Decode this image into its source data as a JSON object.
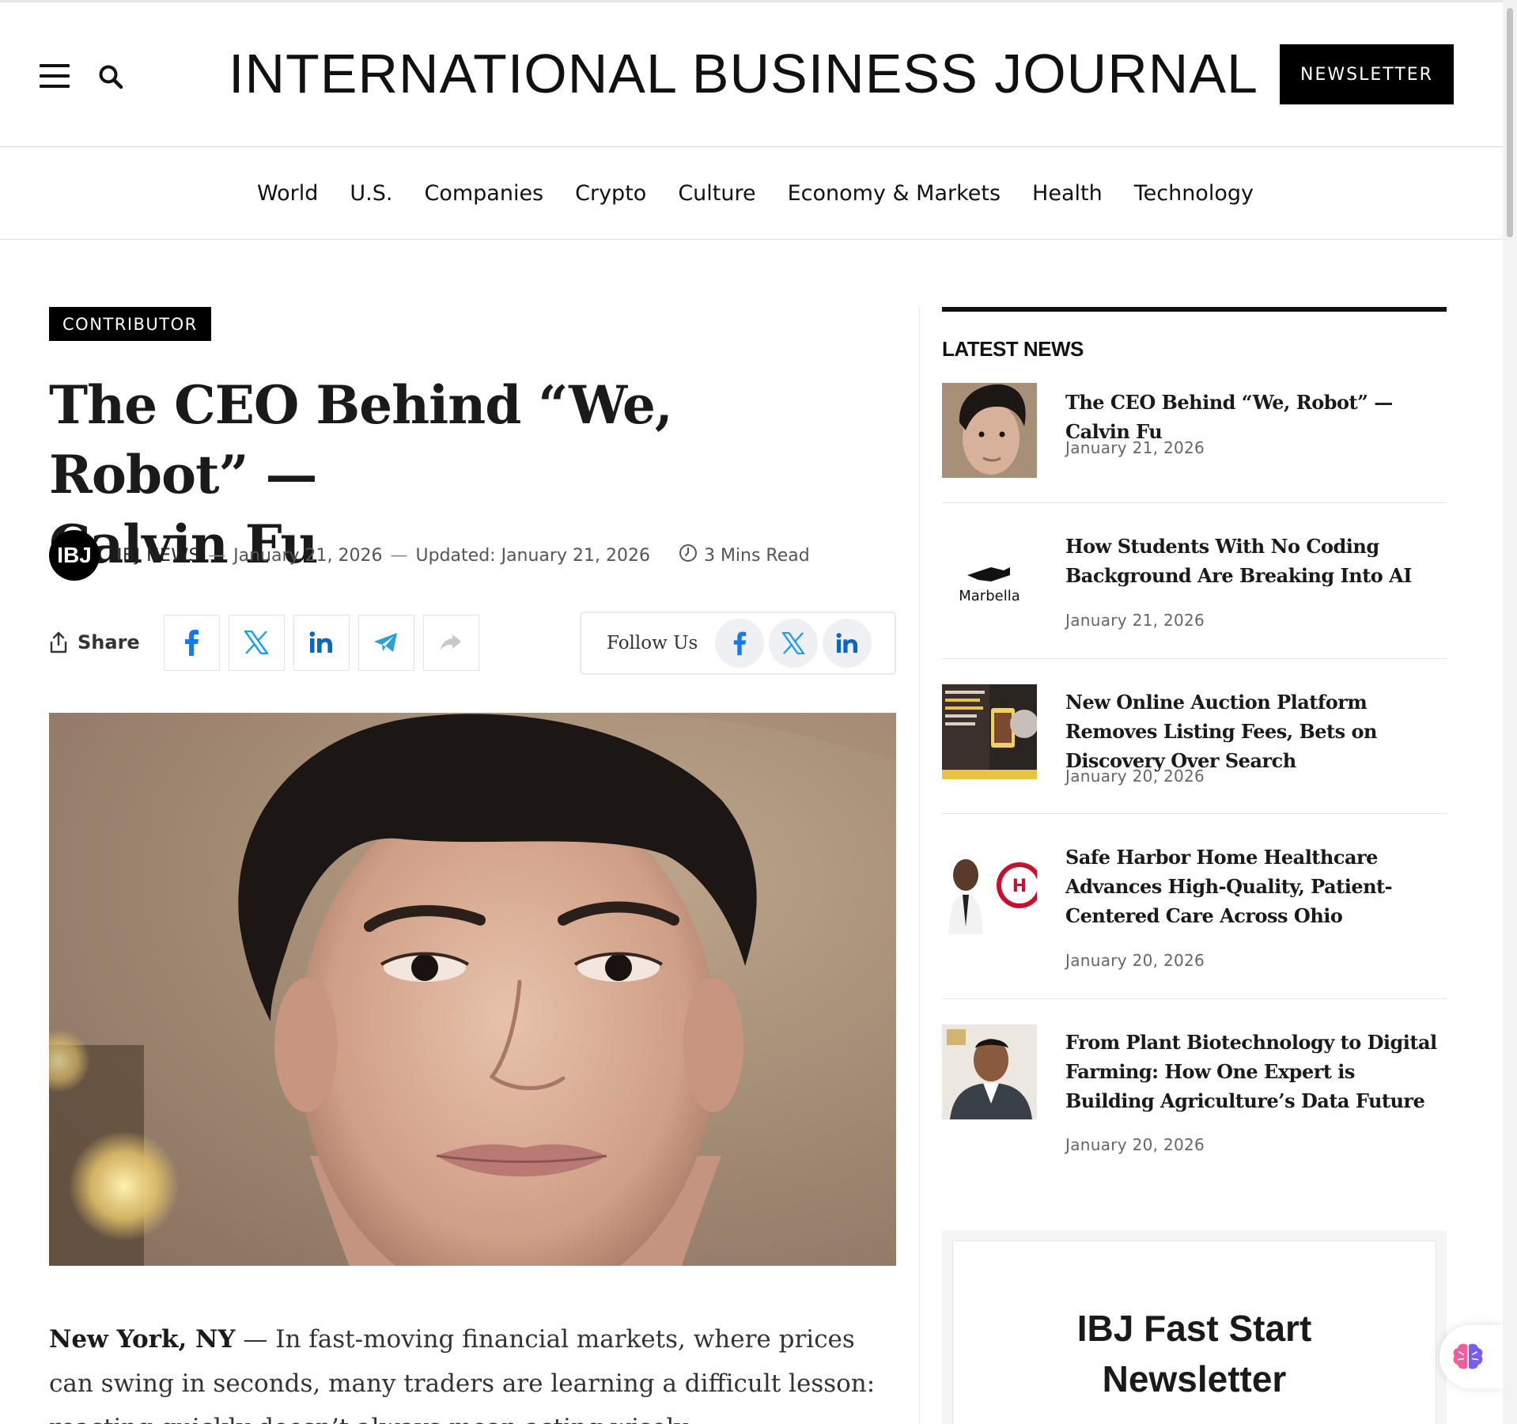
{
  "header": {
    "site_title": "INTERNATIONAL BUSINESS JOURNAL",
    "newsletter_label": "NEWSLETTER"
  },
  "nav": [
    "World",
    "U.S.",
    "Companies",
    "Crypto",
    "Culture",
    "Economy & Markets",
    "Health",
    "Technology"
  ],
  "article": {
    "category": "CONTRIBUTOR",
    "title_line1": "The CEO Behind “We, Robot” —",
    "title_line2": "Calvin Fu",
    "avatar_text": "IBJ",
    "author": "IBJ NEWS",
    "date_sep": "—",
    "published": "January 21, 2026",
    "updated_label": "Updated:",
    "updated": "January 21, 2026",
    "read_time": "3 Mins Read",
    "share_label": "Share",
    "follow_label": "Follow Us",
    "lead_location": "New York, NY",
    "lead_text": " — In fast-moving financial markets, where prices can swing in seconds, many traders are learning a difficult lesson: reacting quickly doesn’t always mean acting wisely."
  },
  "sidebar": {
    "heading": "LATEST NEWS",
    "items": [
      {
        "title": "The CEO Behind “We, Robot” — Calvin Fu",
        "date": "January 21, 2026"
      },
      {
        "title": "How Students With No Coding Background Are Breaking Into AI",
        "date": "January 21, 2026",
        "thumb_text": "Marbella"
      },
      {
        "title": "New Online Auction Platform Removes Listing Fees, Bets on Discovery Over Search",
        "date": "January 20, 2026"
      },
      {
        "title": "Safe Harbor Home Healthcare Advances High-Quality, Patient-Centered Care Across Ohio",
        "date": "January 20, 2026"
      },
      {
        "title": "From Plant Biotechnology to Digital Farming: How One Expert is Building Agriculture’s Data Future",
        "date": "January 20, 2026"
      }
    ],
    "promo_line1": "IBJ Fast Start",
    "promo_line2": "Newsletter"
  },
  "icons": {
    "menu": "hamburger-icon",
    "search": "search-icon",
    "share": "share-icon",
    "clock": "clock-icon",
    "facebook": "facebook-icon",
    "x": "x-icon",
    "linkedin": "linkedin-icon",
    "telegram": "telegram-icon",
    "forward": "forward-icon",
    "ai": "brain-icon"
  },
  "colors": {
    "brand_black": "#000000",
    "facebook": "#1877f2",
    "x": "#1d9bf0",
    "linkedin": "#0a66c2",
    "telegram": "#2a9fd8"
  }
}
